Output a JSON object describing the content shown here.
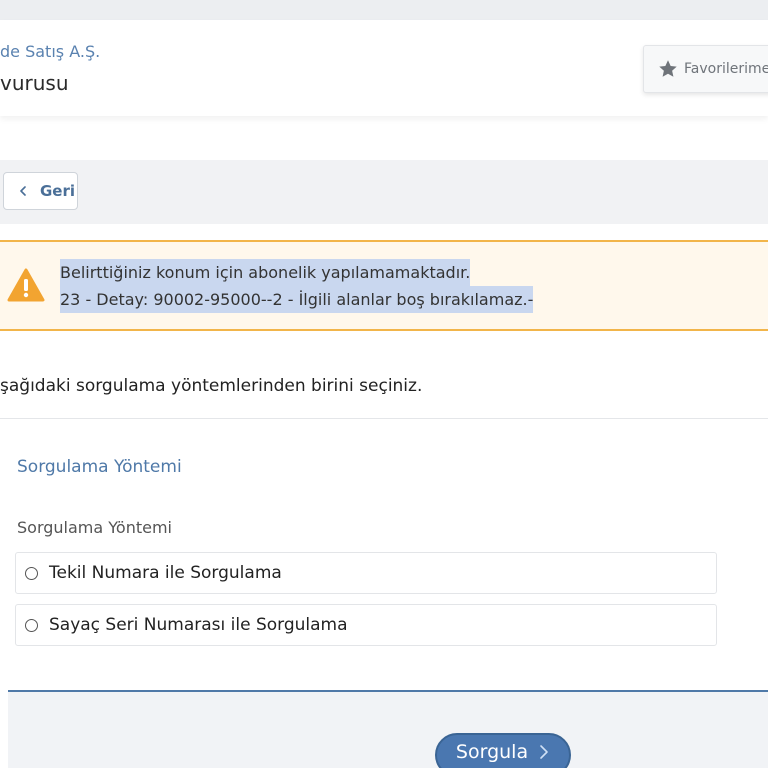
{
  "header": {
    "institution": "de Satış A.Ş.",
    "service_title": "vurusu",
    "favorites_label": "Favorilerime"
  },
  "nav": {
    "back_label": "Geri"
  },
  "alert": {
    "line1": "Belirttiğiniz konum için abonelik yapılamamaktadır.",
    "line2": "23 - Detay: 90002-95000--2 - İlgili alanlar boş bırakılamaz.-"
  },
  "instruction": "şağıdaki sorgulama yöntemlerinden birini seçiniz.",
  "form": {
    "section_title": "Sorgulama Yöntemi",
    "field_label": "Sorgulama Yöntemi",
    "options": [
      {
        "label": "Tekil Numara ile Sorgulama",
        "selected": false
      },
      {
        "label": "Sayaç Seri Numarası ile Sorgulama",
        "selected": false
      }
    ],
    "submit_label": "Sorgula"
  },
  "icons": {
    "favorites": "star-icon",
    "back": "chevron-left-icon",
    "alert": "warning-triangle-icon",
    "submit": "chevron-right-icon"
  },
  "colors": {
    "accent": "#4a77b0",
    "link_blue": "#4f79a8",
    "warning": "#f2a431",
    "alert_bg": "#fff8ec",
    "highlight": "#c9d7ef"
  }
}
